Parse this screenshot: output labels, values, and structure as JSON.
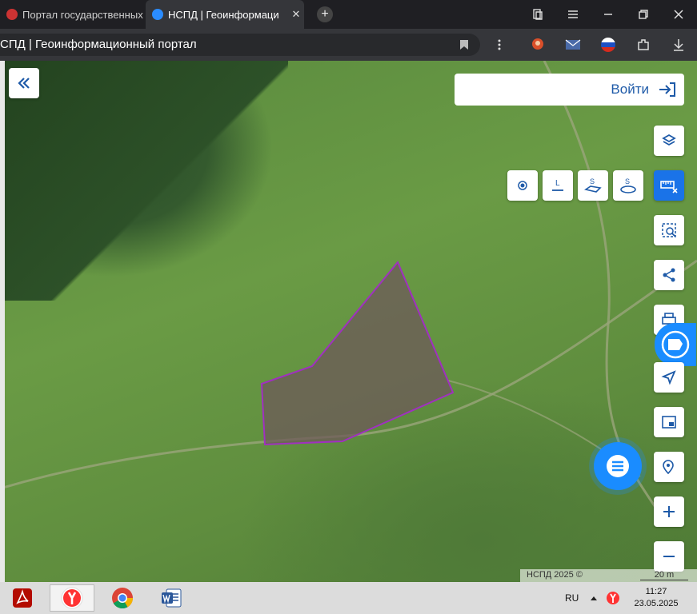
{
  "browser": {
    "tabs": [
      {
        "label": "Портал государственных"
      },
      {
        "label": "НСПД | Геоинформаци"
      }
    ],
    "new_tab": "+",
    "close": "✕",
    "address": "СПД | Геоинформационный портал"
  },
  "map": {
    "login_label": "Войти",
    "attribution": "НСПД 2025 ©",
    "scale": "20 m"
  },
  "taskbar": {
    "lang": "RU",
    "time": "11:27",
    "date": "23.05.2025"
  },
  "colors": {
    "accent": "#1a73e8",
    "parcel": "#a030c0"
  }
}
